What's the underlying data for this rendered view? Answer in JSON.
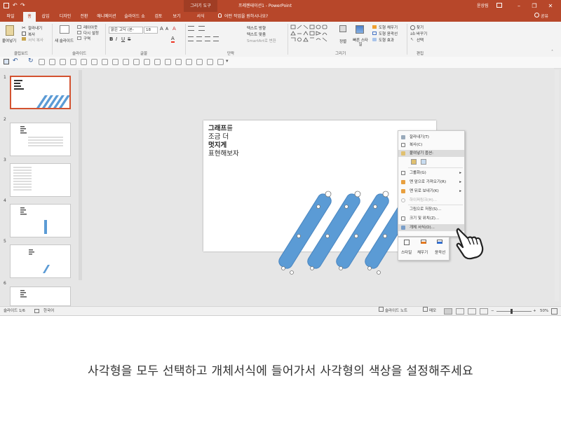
{
  "titlebar": {
    "context_tools": "그리기 도구",
    "doc_title": "프레젠테이션1 - PowerPoint",
    "user": "윤상림",
    "controls": [
      "–",
      "❐",
      "✕"
    ]
  },
  "tabs": {
    "items": [
      "파일",
      "홈",
      "삽입",
      "디자인",
      "전환",
      "애니메이션",
      "슬라이드 쇼",
      "검토",
      "보기",
      "서식"
    ],
    "active": "홈",
    "tellme": "어떤 작업을 원하시나요?",
    "share": "공유"
  },
  "ribbon": {
    "clipboard": {
      "label": "클립보드",
      "paste": "붙여넣기",
      "cut": "잘라내기",
      "copy": "복사",
      "format_painter": "서식 복사"
    },
    "slides": {
      "label": "슬라이드",
      "new_slide": "새 슬라이드",
      "layout": "레이아웃",
      "reset": "다시 설정",
      "section": "구역"
    },
    "font": {
      "label": "글꼴",
      "font_name": "맑은 고딕 (본-",
      "font_size": "18"
    },
    "paragraph": {
      "label": "단락",
      "text_direction": "텍스트 방향",
      "align_text": "텍스트 맞춤",
      "smartart": "SmartArt로 변환"
    },
    "drawing": {
      "label": "그리기",
      "arrange": "정렬",
      "quick_styles": "빠른 스타일",
      "shape_fill": "도형 채우기",
      "shape_outline": "도형 윤곽선",
      "shape_effects": "도형 효과"
    },
    "editing": {
      "label": "편집",
      "find": "찾기",
      "replace": "바꾸기",
      "select": "선택"
    }
  },
  "thumbnails": [
    "1",
    "2",
    "3",
    "4",
    "5",
    "6"
  ],
  "slide_text": {
    "line1_bold": "그래프",
    "line1_rest": "를",
    "line2": "조금 더",
    "line3": "멋지게",
    "line4": "표현해보자"
  },
  "context_menu": {
    "items": [
      {
        "label": "잘라내기(T)"
      },
      {
        "label": "복사(C)"
      },
      {
        "label": "붙여넣기 옵션:"
      },
      {
        "label": "그룹화(G)"
      },
      {
        "label": "맨 앞으로 가져오기(R)"
      },
      {
        "label": "맨 뒤로 보내기(K)"
      },
      {
        "label": "하이퍼링크(H)..."
      },
      {
        "label": "그림으로 저장(S)..."
      },
      {
        "label": "크기 및 위치(Z)..."
      },
      {
        "label": "개체 서식(O)..."
      }
    ]
  },
  "mini_toolbar": {
    "style": "스타일",
    "fill": "채우기",
    "outline": "윤곽선"
  },
  "statusbar": {
    "slide_info": "슬라이드 1/6",
    "language": "한국어",
    "notes": "슬라이드 노트",
    "comments": "메모",
    "zoom": "50%"
  },
  "caption": "사각형을 모두 선택하고 개체서식에 들어가서 사각형의 색상을 설정해주세요",
  "colors": {
    "accent": "#b7472a",
    "shape": "#5b9bd5",
    "selection": "#d35230"
  }
}
